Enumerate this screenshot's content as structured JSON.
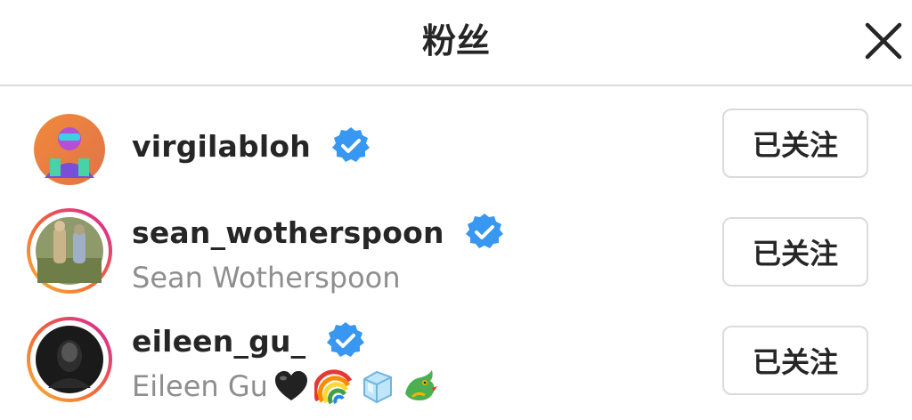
{
  "dialog": {
    "title": "粉丝",
    "close_icon": "close-icon"
  },
  "colors": {
    "verified_blue": "#3897f0",
    "secondary_text": "#8e8e8e",
    "border": "#dbdbdb",
    "story_ring_start": "#f9b233",
    "story_ring_end": "#d6249f"
  },
  "followers": [
    {
      "username": "virgilabloh",
      "full_name": "",
      "verified": true,
      "has_story_ring": false,
      "button_label": "已关注",
      "emojis": []
    },
    {
      "username": "sean_wotherspoon",
      "full_name": "Sean Wotherspoon",
      "verified": true,
      "has_story_ring": true,
      "button_label": "已关注",
      "emojis": []
    },
    {
      "username": "eileen_gu_",
      "full_name": "Eileen Gu",
      "verified": true,
      "has_story_ring": true,
      "button_label": "已关注",
      "emojis": [
        "black-heart-emoji",
        "rainbow-emoji",
        "ice-cube-emoji",
        "dragon-emoji"
      ]
    }
  ]
}
